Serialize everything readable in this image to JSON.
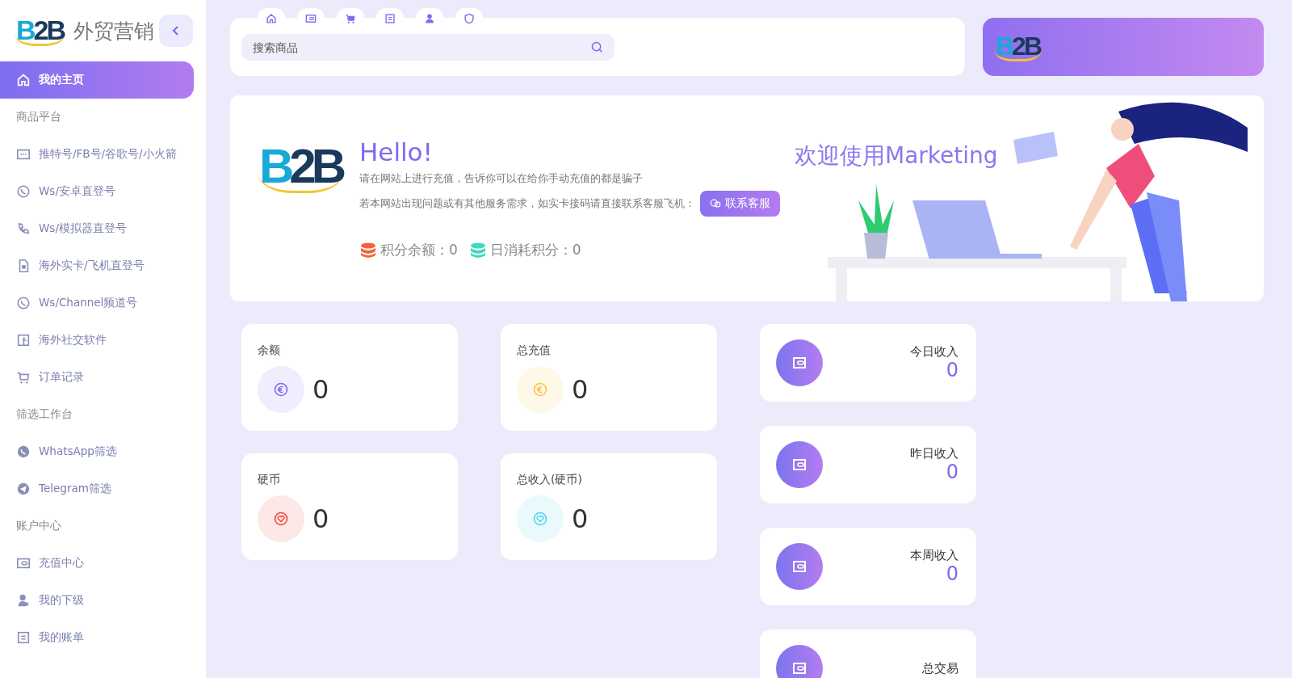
{
  "sidebar": {
    "logo": "B2B",
    "title": "外贸营销",
    "items": [
      {
        "kind": "item",
        "label": "我的主页",
        "selected": true
      },
      {
        "kind": "section",
        "label": "商品平台"
      },
      {
        "kind": "item",
        "label": "推特号/FB号/谷歌号/小火箭",
        "selected": false
      },
      {
        "kind": "item",
        "label": "Ws/安卓直登号",
        "selected": false
      },
      {
        "kind": "item",
        "label": "Ws/模拟器直登号",
        "selected": false
      },
      {
        "kind": "item",
        "label": "海外实卡/飞机直登号",
        "selected": false
      },
      {
        "kind": "item",
        "label": "Ws/Channel频道号",
        "selected": false
      },
      {
        "kind": "item",
        "label": "海外社交软件",
        "selected": false
      },
      {
        "kind": "item",
        "label": "订单记录",
        "selected": false
      },
      {
        "kind": "section",
        "label": "筛选工作台"
      },
      {
        "kind": "item",
        "label": "WhatsApp筛选",
        "selected": false
      },
      {
        "kind": "item",
        "label": "Telegram筛选",
        "selected": false
      },
      {
        "kind": "section",
        "label": "账户中心"
      },
      {
        "kind": "item",
        "label": "充值中心",
        "selected": false
      },
      {
        "kind": "item",
        "label": "我的下级",
        "selected": false
      },
      {
        "kind": "item",
        "label": "我的账单",
        "selected": false
      }
    ]
  },
  "search": {
    "placeholder": "搜索商品"
  },
  "banner": {
    "logo": "B2B"
  },
  "hero": {
    "logo": "B2B",
    "title": "Hello!",
    "lines": [
      "请在网站上进行充值，告诉你可以在给你手动充值的都是骗子",
      "若本网站出现问题或有其他服务需求，如实卡接码请直接联系客服飞机："
    ],
    "contact_button": "联系客服",
    "welcome": "欢迎使用Marketing",
    "points": [
      {
        "label": "积分余额：0",
        "color": "#f4643c"
      },
      {
        "label": "日消耗积分：0",
        "color": "#3ed8c3"
      }
    ]
  },
  "stat_cards": [
    {
      "label": "余额",
      "value": "0",
      "kind": "coin",
      "color": "#7b6cf6"
    },
    {
      "label": "总充值",
      "value": "0",
      "kind": "coin",
      "color": "#f8c24a"
    },
    {
      "label": "硬币",
      "value": "0",
      "kind": "gem",
      "color": "#f0443c"
    },
    {
      "label": "总收入(硬币)",
      "value": "0",
      "kind": "gem",
      "color": "#4fd6ea"
    }
  ],
  "income_cards": [
    {
      "label": "今日收入",
      "value": "0"
    },
    {
      "label": "昨日收入",
      "value": "0"
    },
    {
      "label": "本周收入",
      "value": "0"
    },
    {
      "label": "总交易"
    }
  ]
}
